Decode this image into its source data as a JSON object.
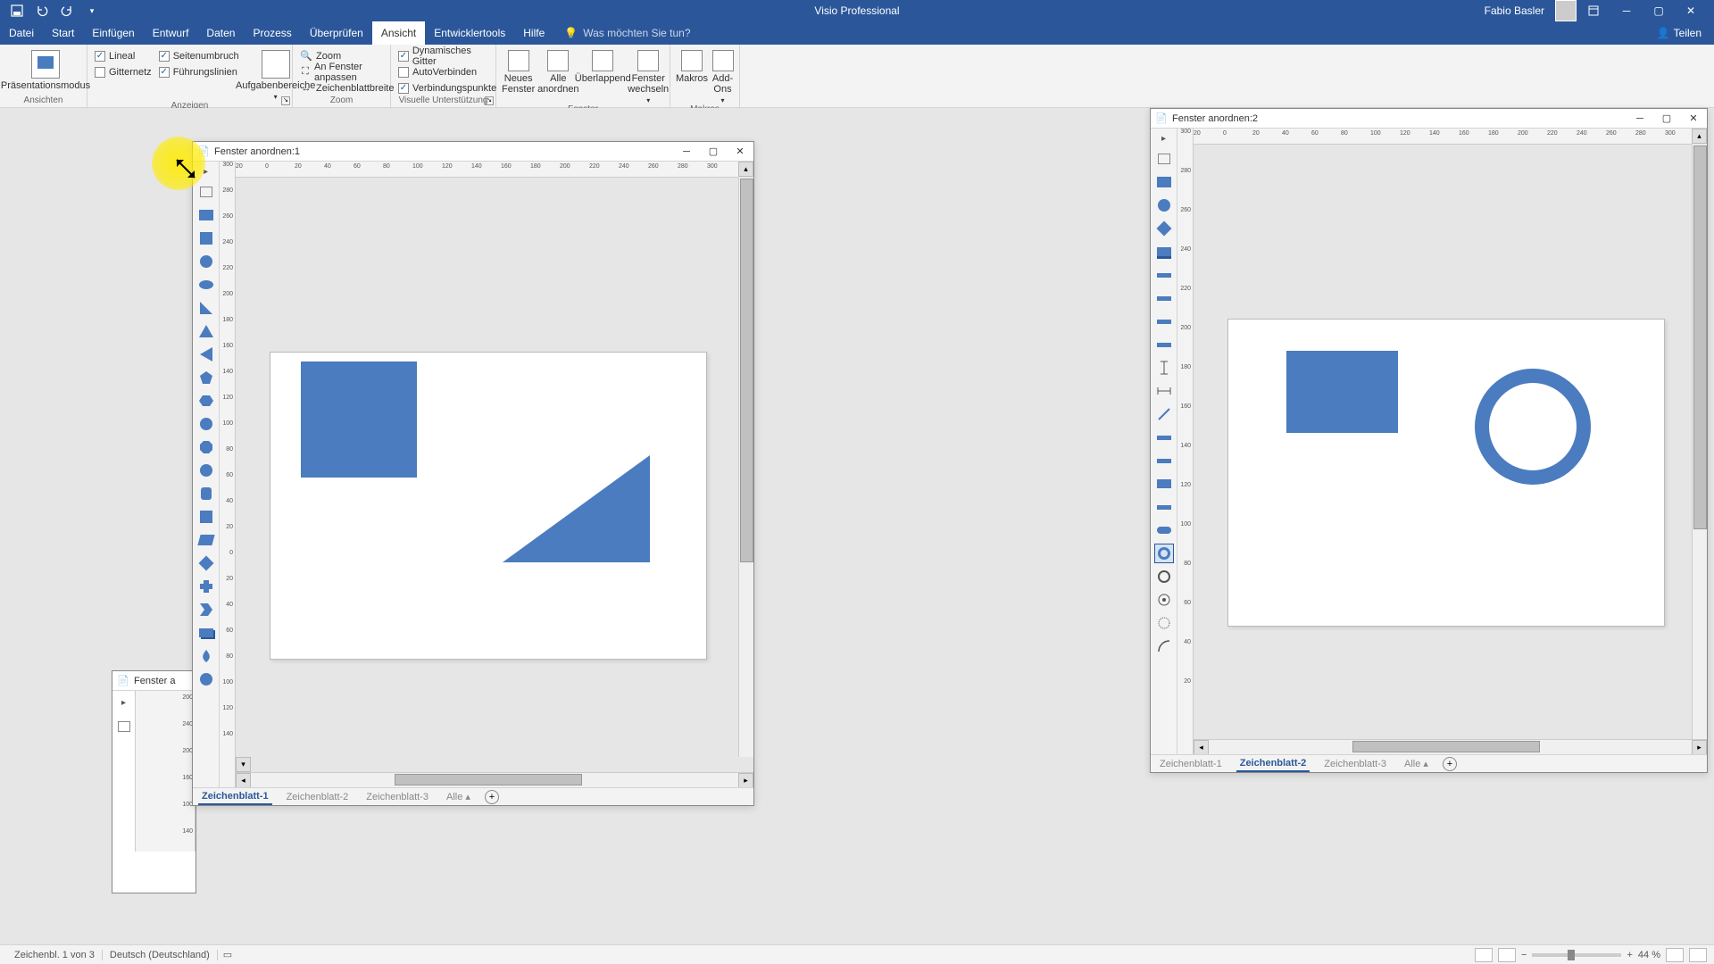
{
  "app": {
    "title": "Visio Professional",
    "user": "Fabio Basler"
  },
  "menu": {
    "file": "Datei",
    "start": "Start",
    "insert": "Einfügen",
    "design": "Entwurf",
    "data": "Daten",
    "process": "Prozess",
    "review": "Überprüfen",
    "view": "Ansicht",
    "dev": "Entwicklertools",
    "help": "Hilfe",
    "tellme": "Was möchten Sie tun?",
    "share": "Teilen"
  },
  "ribbon": {
    "views": {
      "presentation": "Präsentationsmodus",
      "group": "Ansichten"
    },
    "show": {
      "ruler": "Lineal",
      "grid": "Gitternetz",
      "pagebreaks": "Seitenumbruch",
      "guides": "Führungslinien",
      "taskpanes": "Aufgabenbereiche",
      "group": "Anzeigen"
    },
    "zoom": {
      "zoom": "Zoom",
      "fitwindow": "An Fenster anpassen",
      "pagewidth": "Zeichenblattbreite",
      "group": "Zoom"
    },
    "visual": {
      "dyngrid": "Dynamisches Gitter",
      "autoconnect": "AutoVerbinden",
      "connpoints": "Verbindungspunkte",
      "group": "Visuelle Unterstützung"
    },
    "window": {
      "new": "Neues Fenster",
      "arrange": "Alle anordnen",
      "cascade": "Überlappend",
      "switch": "Fenster wechseln",
      "group": "Fenster"
    },
    "macros": {
      "macros": "Makros",
      "addons": "Add-Ons",
      "group": "Makros"
    }
  },
  "win1": {
    "title": "Fenster anordnen:1",
    "tabs": {
      "t1": "Zeichenblatt-1",
      "t2": "Zeichenblatt-2",
      "t3": "Zeichenblatt-3",
      "all": "Alle"
    },
    "ruler_h": [
      "20",
      "0",
      "20",
      "40",
      "60",
      "80",
      "100",
      "120",
      "140",
      "160",
      "180",
      "200",
      "220",
      "240",
      "260",
      "280",
      "300"
    ],
    "ruler_v": [
      "300",
      "280",
      "260",
      "240",
      "220",
      "200",
      "180",
      "160",
      "140",
      "120",
      "100",
      "80",
      "60",
      "40",
      "20",
      "0",
      "20",
      "40",
      "60",
      "80",
      "100",
      "120",
      "140"
    ]
  },
  "win2": {
    "title": "Fenster anordnen:2",
    "tabs": {
      "t1": "Zeichenblatt-1",
      "t2": "Zeichenblatt-2",
      "t3": "Zeichenblatt-3",
      "all": "Alle"
    },
    "ruler_h": [
      "20",
      "0",
      "20",
      "40",
      "60",
      "80",
      "100",
      "120",
      "140",
      "160",
      "180",
      "200",
      "220",
      "240",
      "260",
      "280",
      "300"
    ],
    "ruler_v": [
      "300",
      "280",
      "260",
      "240",
      "220",
      "200",
      "180",
      "160",
      "140",
      "120",
      "100",
      "80",
      "60",
      "40",
      "20"
    ]
  },
  "win3": {
    "title": "Fenster a"
  },
  "status": {
    "sheet": "Zeichenbl. 1 von 3",
    "lang": "Deutsch (Deutschland)",
    "zoom": "44 %"
  }
}
